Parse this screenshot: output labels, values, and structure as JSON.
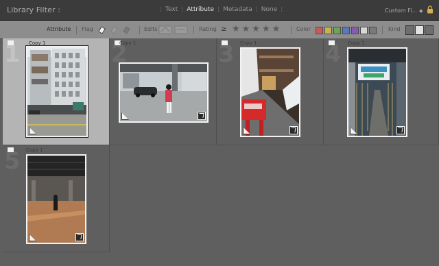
{
  "header": {
    "title": "Library Filter :",
    "tabs": [
      "Text",
      "Attribute",
      "Metadata",
      "None"
    ],
    "active_tab": "Attribute",
    "preset": "Custom Fi..."
  },
  "attribute_bar": {
    "attribute_label": "Attribute",
    "flag_label": "Flag",
    "edits_label": "Edits",
    "rating_label": "Rating",
    "rating_operator": "≥",
    "rating_stars": "★★★★★",
    "color_label": "Color",
    "kind_label": "Kind",
    "swatches": [
      "#c85a5a",
      "#c9b24a",
      "#6aa55a",
      "#5a78c0",
      "#8a5ab0",
      "#d8d8d8",
      "#7a7a7a"
    ]
  },
  "grid": {
    "cells": [
      {
        "index": "1",
        "caption": "Copy 1",
        "selected": true
      },
      {
        "index": "2",
        "caption": "Copy 1",
        "selected": false
      },
      {
        "index": "3",
        "caption": "Copy 1",
        "selected": false
      },
      {
        "index": "4",
        "caption": "Copy 1",
        "selected": false
      },
      {
        "index": "5",
        "caption": "Copy 1",
        "selected": false
      }
    ]
  }
}
